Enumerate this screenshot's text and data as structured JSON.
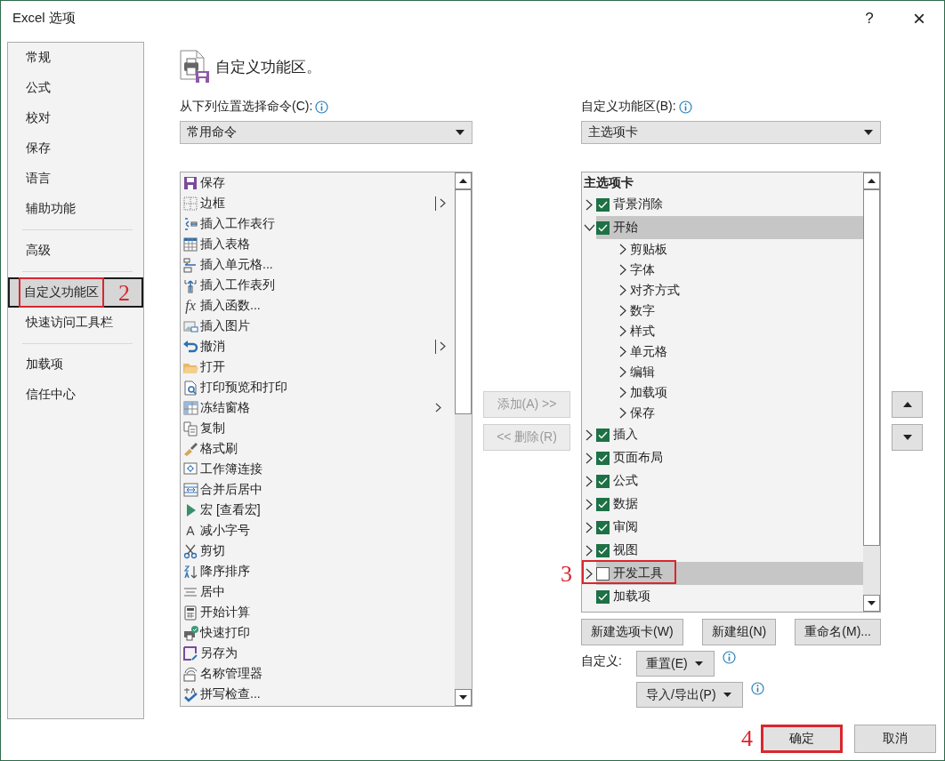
{
  "window": {
    "title": "Excel 选项",
    "help": "?",
    "close": "×"
  },
  "sidebar": {
    "groups": [
      [
        {
          "label": "常规",
          "selected": false
        },
        {
          "label": "公式",
          "selected": false
        },
        {
          "label": "校对",
          "selected": false
        },
        {
          "label": "保存",
          "selected": false
        },
        {
          "label": "语言",
          "selected": false
        },
        {
          "label": "辅助功能",
          "selected": false
        }
      ],
      [
        {
          "label": "高级",
          "selected": false
        }
      ],
      [
        {
          "label": "自定义功能区",
          "selected": true,
          "annotation": "2"
        },
        {
          "label": "快速访问工具栏",
          "selected": false
        }
      ],
      [
        {
          "label": "加载项",
          "selected": false
        },
        {
          "label": "信任中心",
          "selected": false
        }
      ]
    ]
  },
  "page": {
    "title": "自定义功能区。"
  },
  "commands": {
    "label": "从下列位置选择命令(C):",
    "dropdown": "常用命令",
    "items": [
      {
        "label": "保存",
        "kind": "save",
        "submenu": false,
        "split": false
      },
      {
        "label": "边框",
        "kind": "border",
        "submenu": true,
        "split": true
      },
      {
        "label": "插入工作表行",
        "kind": "insertrow",
        "submenu": false,
        "split": false
      },
      {
        "label": "插入表格",
        "kind": "table",
        "submenu": false,
        "split": false
      },
      {
        "label": "插入单元格...",
        "kind": "insertcell",
        "submenu": false,
        "split": false
      },
      {
        "label": "插入工作表列",
        "kind": "insertcol",
        "submenu": false,
        "split": false
      },
      {
        "label": "插入函数...",
        "kind": "fx",
        "icon_text": "fx",
        "submenu": false,
        "split": false
      },
      {
        "label": "插入图片",
        "kind": "picture",
        "submenu": false,
        "split": false
      },
      {
        "label": "撤消",
        "kind": "undo",
        "submenu": true,
        "split": true
      },
      {
        "label": "打开",
        "kind": "open",
        "submenu": false,
        "split": false
      },
      {
        "label": "打印预览和打印",
        "kind": "preview",
        "submenu": false,
        "split": false
      },
      {
        "label": "冻结窗格",
        "kind": "freeze",
        "submenu": true,
        "split": false
      },
      {
        "label": "复制",
        "kind": "copy",
        "submenu": false,
        "split": false
      },
      {
        "label": "格式刷",
        "kind": "painter",
        "submenu": false,
        "split": false
      },
      {
        "label": "工作簿连接",
        "kind": "connections",
        "submenu": false,
        "split": false
      },
      {
        "label": "合并后居中",
        "kind": "merge",
        "submenu": false,
        "split": false
      },
      {
        "label": "宏 [查看宏]",
        "kind": "macro",
        "submenu": false,
        "split": false
      },
      {
        "label": "减小字号",
        "kind": "font",
        "icon_text": "A",
        "submenu": false,
        "split": false
      },
      {
        "label": "剪切",
        "kind": "cut",
        "submenu": false,
        "split": false
      },
      {
        "label": "降序排序",
        "kind": "sort",
        "submenu": false,
        "split": false
      },
      {
        "label": "居中",
        "kind": "center",
        "submenu": false,
        "split": false
      },
      {
        "label": "开始计算",
        "kind": "calc",
        "submenu": false,
        "split": false
      },
      {
        "label": "快速打印",
        "kind": "print",
        "submenu": false,
        "split": false
      },
      {
        "label": "另存为",
        "kind": "saveas",
        "submenu": false,
        "split": false
      },
      {
        "label": "名称管理器",
        "kind": "names",
        "submenu": false,
        "split": false
      },
      {
        "label": "拼写检查...",
        "kind": "spell",
        "submenu": false,
        "split": false
      }
    ]
  },
  "transfer_buttons": [
    {
      "label": "添加(A) >>",
      "disabled": true
    },
    {
      "label": "<< 删除(R)",
      "disabled": true
    }
  ],
  "ribbon": {
    "label": "自定义功能区(B):",
    "dropdown": "主选项卡",
    "header": "主选项卡",
    "items": [
      {
        "label": "背景消除",
        "checked": true,
        "expandable": true,
        "expanded": false,
        "selected": false
      },
      {
        "label": "开始",
        "checked": true,
        "expandable": true,
        "expanded": true,
        "selected": true,
        "children": [
          {
            "label": "剪贴板",
            "expanded": false
          },
          {
            "label": "字体",
            "expanded": false
          },
          {
            "label": "对齐方式",
            "expanded": false
          },
          {
            "label": "数字",
            "expanded": false
          },
          {
            "label": "样式",
            "expanded": false
          },
          {
            "label": "单元格",
            "expanded": false
          },
          {
            "label": "编辑",
            "expanded": false
          },
          {
            "label": "加载项",
            "expanded": false
          },
          {
            "label": "保存",
            "expanded": false
          }
        ]
      },
      {
        "label": "插入",
        "checked": true,
        "expandable": true,
        "expanded": false,
        "selected": false
      },
      {
        "label": "页面布局",
        "checked": true,
        "expandable": true,
        "expanded": false,
        "selected": false
      },
      {
        "label": "公式",
        "checked": true,
        "expandable": true,
        "expanded": false,
        "selected": false
      },
      {
        "label": "数据",
        "checked": true,
        "expandable": true,
        "expanded": false,
        "selected": false
      },
      {
        "label": "审阅",
        "checked": true,
        "expandable": true,
        "expanded": false,
        "selected": false
      },
      {
        "label": "视图",
        "checked": true,
        "expandable": true,
        "expanded": false,
        "selected": false
      },
      {
        "label": "开发工具",
        "checked": false,
        "expandable": true,
        "expanded": false,
        "selected": true,
        "annotation": "3"
      },
      {
        "label": "加载项",
        "checked": true,
        "selected": false
      }
    ]
  },
  "tree_buttons": [
    "新建选项卡(W)",
    "新建组(N)",
    "重命名(M)..."
  ],
  "customize": {
    "label": "自定义:",
    "reset": "重置(E)",
    "import_export": "导入/导出(P)"
  },
  "footer": [
    {
      "label": "确定",
      "annotation": "4"
    },
    {
      "label": "取消"
    }
  ]
}
